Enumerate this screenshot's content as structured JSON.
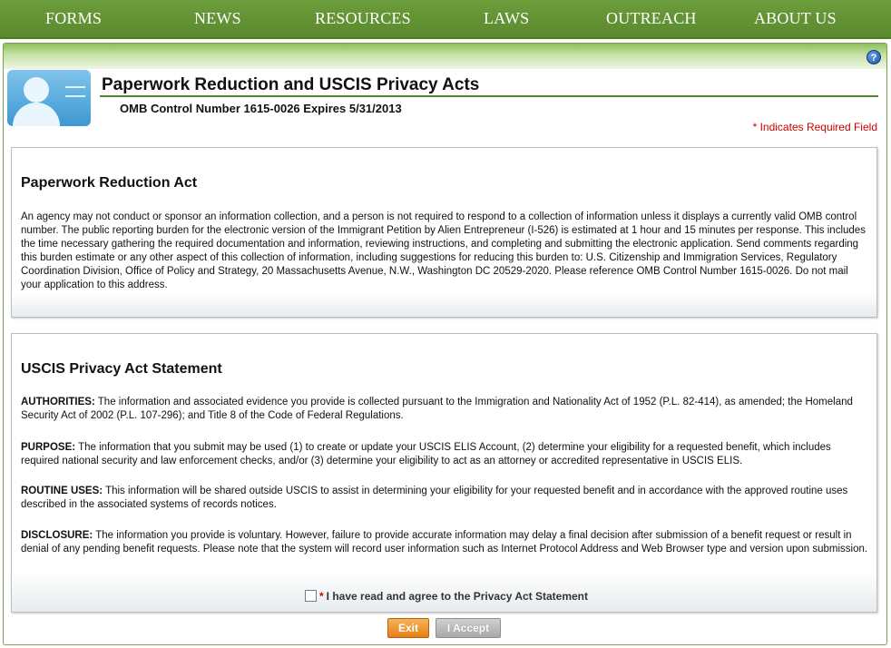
{
  "nav": [
    "FORMS",
    "NEWS",
    "RESOURCES",
    "LAWS",
    "OUTREACH",
    "ABOUT US"
  ],
  "help_glyph": "?",
  "header": {
    "title": "Paperwork Reduction and USCIS Privacy Acts",
    "omb": "OMB Control Number 1615-0026 Expires 5/31/2013",
    "required_note": "* Indicates Required Field"
  },
  "paperwork": {
    "heading": "Paperwork Reduction Act",
    "body": "An agency may not conduct or sponsor an information collection, and a person is not required to respond to a collection of information unless it displays a currently valid OMB control number. The public reporting burden for the electronic version of the Immigrant Petition by Alien Entrepreneur (I-526) is estimated at 1 hour and 15 minutes per response. This includes the time necessary gathering the required documentation and information, reviewing instructions, and completing and submitting the electronic application. Send comments regarding this burden estimate or any other aspect of this collection of information, including suggestions for reducing this burden to: U.S. Citizenship and Immigration Services, Regulatory Coordination Division, Office of Policy and Strategy, 20 Massachusetts Avenue, N.W., Washington DC 20529-2020. Please reference OMB Control Number 1615-0026. Do not mail your application to this address."
  },
  "privacy": {
    "heading": "USCIS Privacy Act Statement",
    "sections": [
      {
        "label": "AUTHORITIES:",
        "text": " The information and associated evidence you provide is collected pursuant to the Immigration and Nationality Act of 1952 (P.L. 82-414), as amended; the Homeland Security Act of 2002 (P.L. 107-296); and Title 8 of the Code of Federal Regulations."
      },
      {
        "label": "PURPOSE:",
        "text": " The information that you submit may be used (1) to create or update your USCIS ELIS Account, (2) determine your eligibility for a requested benefit, which includes required national security and law enforcement checks, and/or (3) determine your eligibility to act as an attorney or accredited representative in USCIS ELIS."
      },
      {
        "label": "ROUTINE USES:",
        "text": " This information will be shared outside USCIS to assist in determining your eligibility for your requested benefit and in accordance with the approved routine uses described in the associated systems of records notices."
      },
      {
        "label": "DISCLOSURE:",
        "text": " The information you provide is voluntary. However, failure to provide accurate information may delay a final decision after submission of a benefit request or result in denial of any pending benefit requests. Please note that the system will record user information such as Internet Protocol Address and Web Browser type and version upon submission."
      }
    ],
    "agree_star": "*",
    "agree_label": "I have read and agree to the Privacy Act Statement"
  },
  "buttons": {
    "exit": "Exit",
    "accept": "I Accept"
  }
}
